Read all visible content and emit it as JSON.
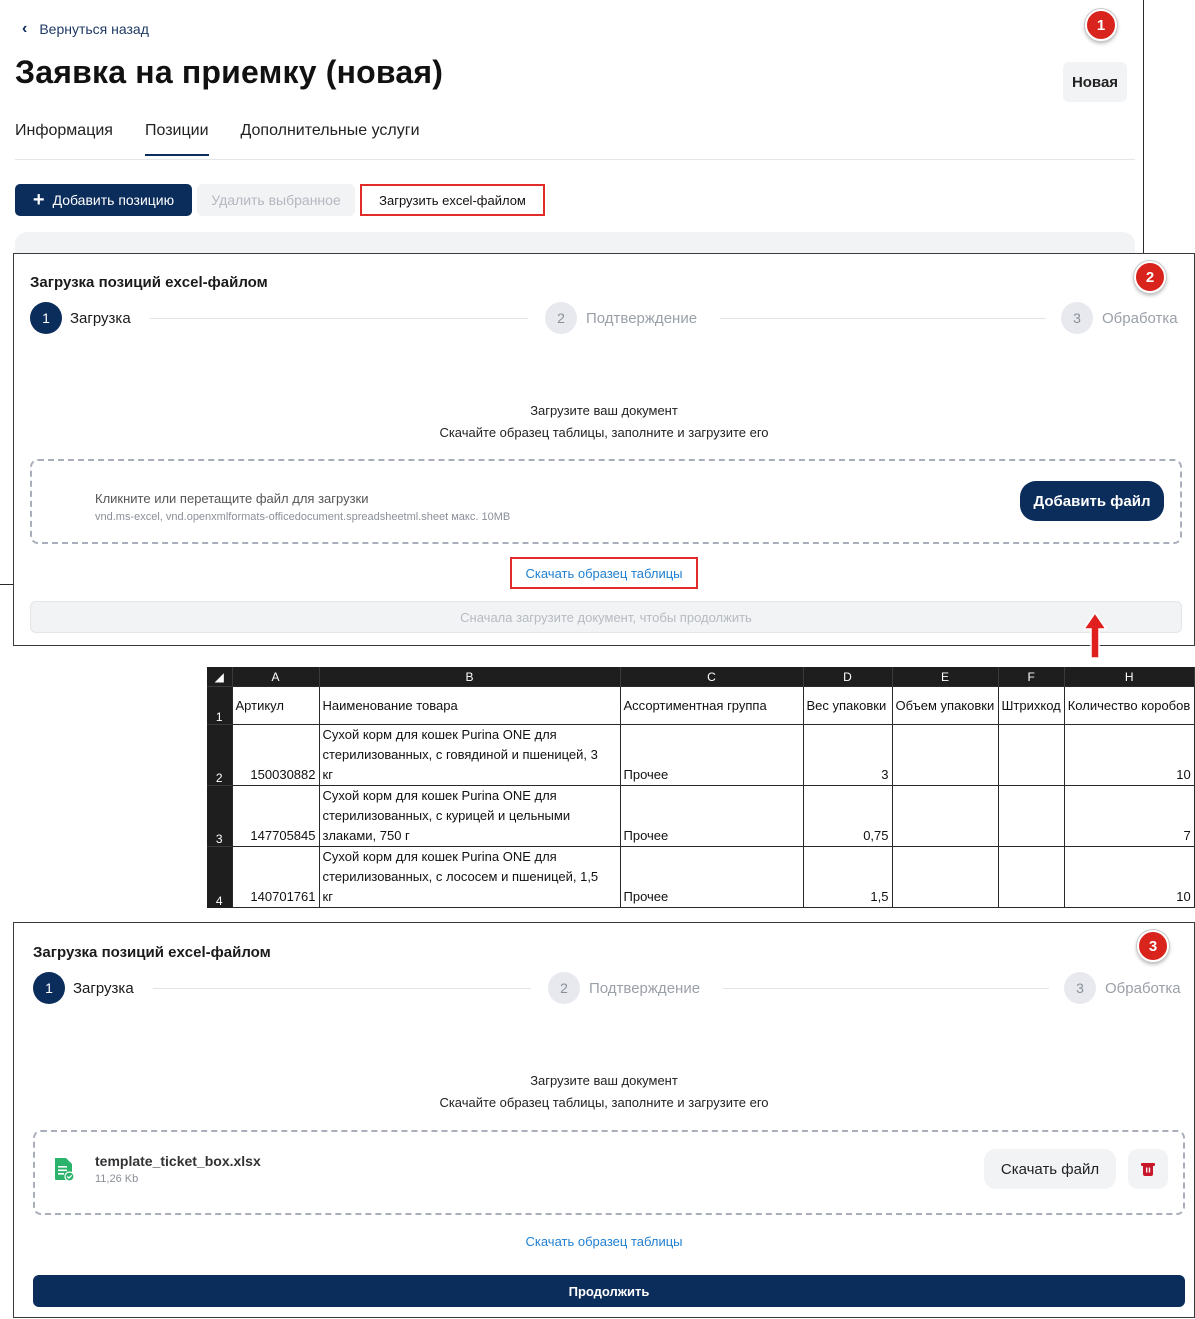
{
  "panel1": {
    "back_label": "Вернуться назад",
    "title": "Заявка на приемку (новая)",
    "status": "Новая",
    "tabs": [
      "Информация",
      "Позиции",
      "Дополнительные услуги"
    ],
    "active_tab": "Позиции",
    "add_position": "Добавить позицию",
    "delete_selected": "Удалить выбранное",
    "upload_excel": "Загрузить excel-файлом",
    "badge": "1"
  },
  "panel2": {
    "badge": "2",
    "title": "Загрузка позиций excel-файлом",
    "steps": [
      {
        "num": "1",
        "label": "Загрузка"
      },
      {
        "num": "2",
        "label": "Подтверждение"
      },
      {
        "num": "3",
        "label": "Обработка"
      }
    ],
    "line1": "Загрузите ваш документ",
    "line2": "Скачайте образец таблицы, заполните и загрузите его",
    "drop_main": "Кликните или перетащите файл для загрузки",
    "drop_sub": "vnd.ms-excel, vnd.openxmlformats-officedocument.spreadsheetml.sheet макс. 10MB",
    "add_file": "Добавить файл",
    "download_sample": "Скачать образец таблицы",
    "continue_disabled": "Сначала загрузите документ, чтобы продолжить"
  },
  "excel": {
    "columns": [
      "A",
      "B",
      "C",
      "D",
      "E",
      "F",
      "H"
    ],
    "headers": [
      "Артикул",
      "Наименование товара",
      "Ассортиментная группа",
      "Вес упаковки",
      "Объем упаковки",
      "Штрихкод",
      "Количество коробов"
    ],
    "rows": [
      {
        "num": "2",
        "article": "150030882",
        "name": [
          "Сухой корм для кошек Purina ONE для",
          "стерилизованных, с говядиной и пшеницей, 3",
          "кг"
        ],
        "group": "Прочее",
        "weight": "3",
        "volume": "",
        "barcode": "",
        "boxes": "10"
      },
      {
        "num": "3",
        "article": "147705845",
        "name": [
          "Сухой корм для кошек Purina ONE для",
          "стерилизованных, с курицей и цельными",
          "злаками, 750 г"
        ],
        "group": "Прочее",
        "weight": "0,75",
        "volume": "",
        "barcode": "",
        "boxes": "7"
      },
      {
        "num": "4",
        "article": "140701761",
        "name": [
          "Сухой корм для кошек Purina ONE для",
          "стерилизованных, с лососем и пшеницей, 1,5",
          "кг"
        ],
        "group": "Прочее",
        "weight": "1,5",
        "volume": "",
        "barcode": "",
        "boxes": "10"
      }
    ],
    "header_row_num": "1"
  },
  "panel3": {
    "badge": "3",
    "title": "Загрузка позиций excel-файлом",
    "steps": [
      {
        "num": "1",
        "label": "Загрузка"
      },
      {
        "num": "2",
        "label": "Подтверждение"
      },
      {
        "num": "3",
        "label": "Обработка"
      }
    ],
    "line1": "Загрузите ваш документ",
    "line2": "Скачайте образец таблицы, заполните и загрузите его",
    "file_name": "template_ticket_box.xlsx",
    "file_size": "11,26 Kb",
    "download_file": "Скачать файл",
    "download_sample": "Скачать образец таблицы",
    "continue": "Продолжить"
  },
  "colors": {
    "primary": "#0b2d5c",
    "highlight_red": "#e22b2b",
    "link": "#1f7fd1",
    "file_green": "#2bb36b"
  }
}
